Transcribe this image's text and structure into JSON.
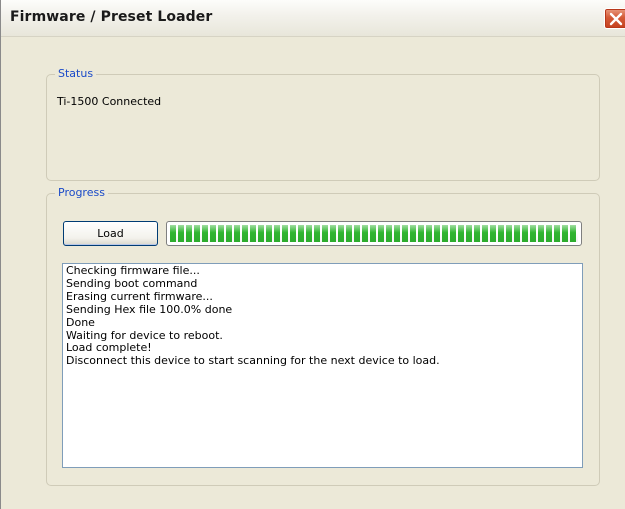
{
  "window": {
    "title": "Firmware / Preset Loader"
  },
  "status": {
    "legend": "Status",
    "text": "Ti-1500 Connected"
  },
  "progress": {
    "legend": "Progress",
    "load_button_label": "Load",
    "progress_percent": 100
  },
  "log": {
    "lines": [
      "Checking firmware file...",
      "Sending boot command",
      "Erasing current firmware...",
      "Sending Hex file 100.0% done",
      "Done",
      "Waiting for device to reboot.",
      "Load complete!",
      "Disconnect this device to start scanning for the next device to load."
    ]
  },
  "colors": {
    "legend_text": "#1a4ac8",
    "progress_fill": "#2fb52f",
    "close_button": "#d45a37"
  },
  "icons": {
    "close": "close-icon"
  }
}
